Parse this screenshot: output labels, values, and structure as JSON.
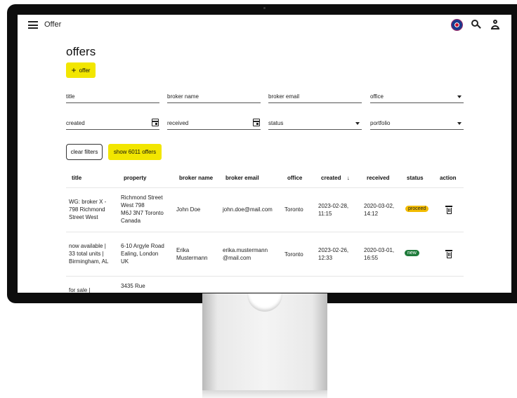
{
  "app": {
    "title": "Offer"
  },
  "page": {
    "title": "offers",
    "add_label": "offer"
  },
  "filters": {
    "title": "title",
    "broker_name": "broker name",
    "broker_email": "broker email",
    "office": "office",
    "created": "created",
    "received": "received",
    "status": "status",
    "portfolio": "portfolio"
  },
  "actions": {
    "clear_label": "clear filters",
    "show_label": "show 6011 offers"
  },
  "table": {
    "headers": {
      "title": "title",
      "property": "property",
      "broker_name": "broker name",
      "broker_email": "broker email",
      "office": "office",
      "created": "created",
      "received": "received",
      "status": "status",
      "action": "action",
      "sort_indicator": "↓"
    },
    "rows": [
      {
        "title": [
          "WG: broker X -",
          "798 Richmond",
          "Street West"
        ],
        "property": [
          "Richmond Street",
          "West 798",
          "M6J 3N7 Toronto",
          "Canada"
        ],
        "broker_name": [
          "John Doe"
        ],
        "broker_email": [
          "john.doe@mail.com"
        ],
        "office": "Toronto",
        "created": [
          "2023-02-28,",
          "11:15"
        ],
        "received": [
          "2020-03-02,",
          "14:12"
        ],
        "status": "proceed"
      },
      {
        "title": [
          "now available |",
          "33 total units |",
          "Birmingham, AL"
        ],
        "property": [
          "6-10 Argyle Road",
          "Ealing, London",
          "UK"
        ],
        "broker_name": [
          "Erika",
          "Mustermann"
        ],
        "broker_email": [
          "erika.mustermann",
          "@mail.com"
        ],
        "office": "Toronto",
        "created": [
          "2023-02-26,",
          "12:33"
        ],
        "received": [
          "2020-03-01,",
          "16:55"
        ],
        "status": "new"
      },
      {
        "title": [
          "for sale |"
        ],
        "property": [
          "3435 Rue"
        ]
      }
    ]
  },
  "colors": {
    "accent": "#f2e600",
    "proceed": "#f2bc00",
    "new": "#1e7a3a"
  }
}
